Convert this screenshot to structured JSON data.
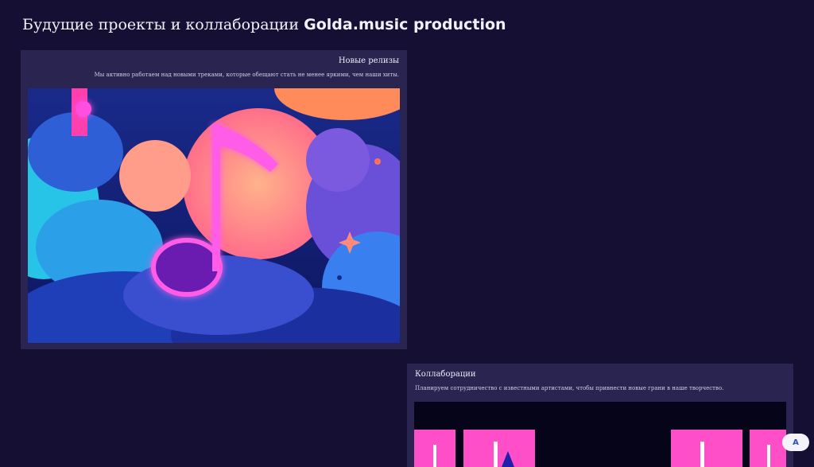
{
  "page": {
    "title_prefix": "Будущие проекты и коллаборации ",
    "title_brand": "Golda.music production"
  },
  "releases": {
    "title": "Новые релизы",
    "text": "Мы активно работаем над новыми треками, которые обещают стать не менее яркими, чем наши хиты.",
    "image_icon": "music-note-icon"
  },
  "collab": {
    "title": "Коллаборации",
    "text": "Планируем сотрудничество с известными артистами, чтобы привнести новые грани в наше творчество."
  },
  "badge": {
    "label": "А"
  },
  "colors": {
    "background": "#140f33",
    "card": "#2a2450",
    "accent_pink": "#ff3fd2",
    "accent_blue": "#3b6cff"
  }
}
